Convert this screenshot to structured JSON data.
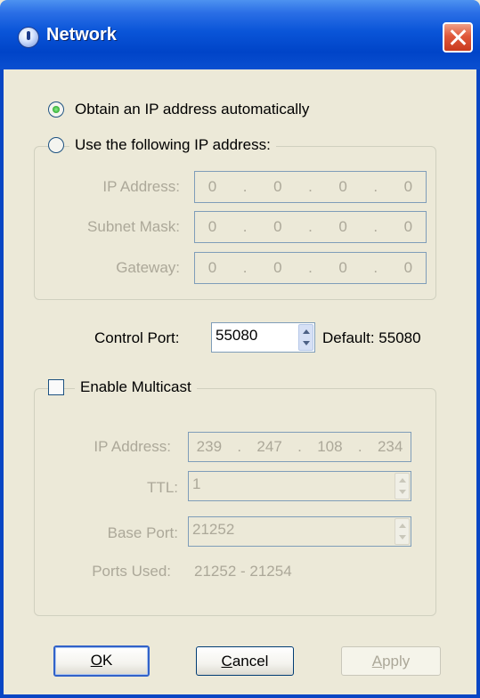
{
  "window": {
    "title": "Network"
  },
  "ip_mode": {
    "auto_label": "Obtain an IP address automatically",
    "manual_label": "Use the following IP address:",
    "selected": "auto"
  },
  "static_ip": {
    "ip_label": "IP Address:",
    "subnet_label": "Subnet Mask:",
    "gateway_label": "Gateway:",
    "ip": [
      "0",
      "0",
      "0",
      "0"
    ],
    "subnet": [
      "0",
      "0",
      "0",
      "0"
    ],
    "gateway": [
      "0",
      "0",
      "0",
      "0"
    ]
  },
  "control_port": {
    "label": "Control Port:",
    "value": "55080",
    "default_text": "Default: 55080"
  },
  "multicast": {
    "enable_label": "Enable Multicast",
    "checked": false,
    "ip_label": "IP Address:",
    "ip": [
      "239",
      "247",
      "108",
      "234"
    ],
    "ttl_label": "TTL:",
    "ttl_value": "1",
    "base_port_label": "Base Port:",
    "base_port_value": "21252",
    "ports_used_label": "Ports Used:",
    "ports_used_value": "21252 - 21254"
  },
  "buttons": {
    "ok_mnemonic": "O",
    "ok_rest": "K",
    "cancel_mnemonic": "C",
    "cancel_rest": "ancel",
    "apply_mnemonic": "A",
    "apply_rest": "pply"
  },
  "colors": {
    "title_bar": "#0a55d8",
    "dialog_bg": "#ece9d8",
    "disabled_text": "#aca899"
  }
}
